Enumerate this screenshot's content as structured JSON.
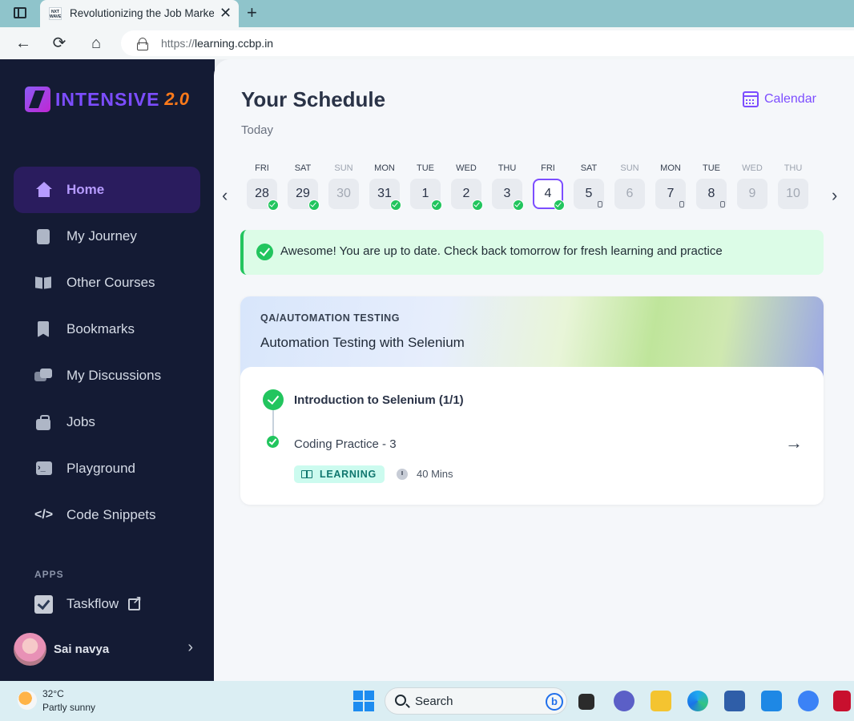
{
  "browser": {
    "tab_title": "Revolutionizing the Job Market |",
    "favicon_text": "NXT WAVE",
    "close_glyph": "✕",
    "new_tab_glyph": "+",
    "back_glyph": "←",
    "reload_glyph": "⟳",
    "home_glyph": "⌂",
    "url_scheme": "https://",
    "url_host": "learning.ccbp.in"
  },
  "sidebar": {
    "logo_text": "INTENSIVE",
    "logo_version": "2.0",
    "items": [
      {
        "label": "Home",
        "icon": "home-icon",
        "active": true
      },
      {
        "label": "My Journey",
        "icon": "journey-icon"
      },
      {
        "label": "Other Courses",
        "icon": "book-icon"
      },
      {
        "label": "Bookmarks",
        "icon": "bookmark-icon"
      },
      {
        "label": "My Discussions",
        "icon": "chat-icon"
      },
      {
        "label": "Jobs",
        "icon": "briefcase-icon"
      },
      {
        "label": "Playground",
        "icon": "terminal-icon"
      },
      {
        "label": "Code Snippets",
        "icon": "code-icon",
        "glyph": "</>"
      }
    ],
    "apps_label": "APPS",
    "taskflow_label": "Taskflow",
    "user_name": "Sai navya",
    "user_chevron": "›"
  },
  "schedule": {
    "title": "Your Schedule",
    "calendar_label": "Calendar",
    "today_label": "Today",
    "prev_glyph": "‹",
    "next_glyph": "›",
    "days": [
      {
        "name": "FRI",
        "date": "28",
        "status": "done"
      },
      {
        "name": "SAT",
        "date": "29",
        "status": "done"
      },
      {
        "name": "SUN",
        "date": "30",
        "status": "off"
      },
      {
        "name": "MON",
        "date": "31",
        "status": "done"
      },
      {
        "name": "TUE",
        "date": "1",
        "status": "done"
      },
      {
        "name": "WED",
        "date": "2",
        "status": "done"
      },
      {
        "name": "THU",
        "date": "3",
        "status": "done"
      },
      {
        "name": "FRI",
        "date": "4",
        "status": "selected"
      },
      {
        "name": "SAT",
        "date": "5",
        "status": "locked"
      },
      {
        "name": "SUN",
        "date": "6",
        "status": "off"
      },
      {
        "name": "MON",
        "date": "7",
        "status": "locked"
      },
      {
        "name": "TUE",
        "date": "8",
        "status": "locked"
      },
      {
        "name": "WED",
        "date": "9",
        "status": "off"
      },
      {
        "name": "THU",
        "date": "10",
        "status": "off"
      }
    ],
    "alert_text": "Awesome! You are up to date. Check back tomorrow for fresh learning and practice",
    "course": {
      "category": "QA/AUTOMATION TESTING",
      "name": "Automation Testing with Selenium",
      "topic": "Introduction to Selenium (1/1)",
      "item": "Coding Practice - 3",
      "arrow_glyph": "→",
      "badge": "LEARNING",
      "duration": "40 Mins"
    }
  },
  "taskbar": {
    "temperature": "32°C",
    "weather": "Partly sunny",
    "search_label": "Search",
    "bing_glyph": "b"
  },
  "colors": {
    "accent": "#7c4dff",
    "success": "#22c55e",
    "sidebar_bg": "#141b34",
    "badge_bg": "#ccfbef"
  }
}
